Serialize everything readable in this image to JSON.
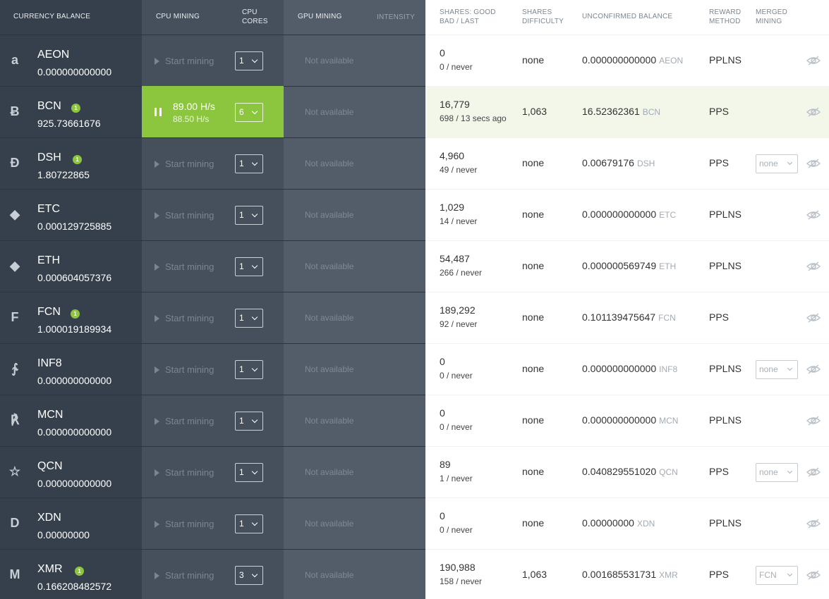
{
  "headers": {
    "currency_balance": "CURRENCY BALANCE",
    "cpu_mining": "CPU MINING",
    "cpu_cores": "CPU CORES",
    "gpu_mining": "GPU MINING",
    "intensity": "INTENSITY",
    "shares": "SHARES: GOOD BAD / LAST",
    "shares_difficulty": "SHARES DIFFICULTY",
    "unconfirmed_balance": "UNCONFIRMED BALANCE",
    "reward_method": "REWARD METHOD",
    "merged_mining": "MERGED MINING"
  },
  "labels": {
    "start_mining": "Start mining",
    "not_available": "Not available",
    "active_rate": "89.00 H/s",
    "active_rate_avg": "88.50 H/s"
  },
  "colors": {
    "accent": "#8cc63f",
    "panel_dark": "#36404c",
    "panel_mid": "#46505c",
    "panel_light": "#535d69"
  },
  "rows": [
    {
      "icon": "aeon-icon",
      "glyph": "a",
      "name": "AEON",
      "badge": "",
      "balance": "0.000000000000",
      "cores": "1",
      "shares_good": "0",
      "shares_bad_last": "0 / never",
      "difficulty": "none",
      "unconfirmed": "0.000000000000",
      "ucur": "AEON",
      "reward": "PPLNS",
      "merged": ""
    },
    {
      "icon": "bcn-icon",
      "glyph": "Ƀ",
      "name": "BCN",
      "badge": "1",
      "balance": "925.73661676",
      "cores": "6",
      "shares_good": "16,779",
      "shares_bad_last": "698 / 13 secs ago",
      "difficulty": "1,063",
      "unconfirmed": "16.52362361",
      "ucur": "BCN",
      "reward": "PPS",
      "merged": "",
      "active": true
    },
    {
      "icon": "dsh-icon",
      "glyph": "Đ",
      "name": "DSH",
      "badge": "1",
      "balance": "1.80722865",
      "cores": "1",
      "shares_good": "4,960",
      "shares_bad_last": "49 / never",
      "difficulty": "none",
      "unconfirmed": "0.00679176",
      "ucur": "DSH",
      "reward": "PPS",
      "merged": "none"
    },
    {
      "icon": "etc-icon",
      "glyph": "◆",
      "name": "ETC",
      "badge": "",
      "balance": "0.000129725885",
      "cores": "1",
      "shares_good": "1,029",
      "shares_bad_last": "14 / never",
      "difficulty": "none",
      "unconfirmed": "0.000000000000",
      "ucur": "ETC",
      "reward": "PPLNS",
      "merged": ""
    },
    {
      "icon": "eth-icon",
      "glyph": "◆",
      "name": "ETH",
      "badge": "",
      "balance": "0.000604057376",
      "cores": "1",
      "shares_good": "54,487",
      "shares_bad_last": "266 / never",
      "difficulty": "none",
      "unconfirmed": "0.000000569749",
      "ucur": "ETH",
      "reward": "PPLNS",
      "merged": ""
    },
    {
      "icon": "fcn-icon",
      "glyph": "F",
      "name": "FCN",
      "badge": "1",
      "balance": "1.000019189934",
      "cores": "1",
      "shares_good": "189,292",
      "shares_bad_last": "92 / never",
      "difficulty": "none",
      "unconfirmed": "0.101139475647",
      "ucur": "FCN",
      "reward": "PPS",
      "merged": ""
    },
    {
      "icon": "inf8-icon",
      "glyph": "∱",
      "name": "INF8",
      "badge": "",
      "balance": "0.000000000000",
      "cores": "1",
      "shares_good": "0",
      "shares_bad_last": "0 / never",
      "difficulty": "none",
      "unconfirmed": "0.000000000000",
      "ucur": "INF8",
      "reward": "PPLNS",
      "merged": "none"
    },
    {
      "icon": "mcn-icon",
      "glyph": "℟",
      "name": "MCN",
      "badge": "",
      "balance": "0.000000000000",
      "cores": "1",
      "shares_good": "0",
      "shares_bad_last": "0 / never",
      "difficulty": "none",
      "unconfirmed": "0.000000000000",
      "ucur": "MCN",
      "reward": "PPLNS",
      "merged": ""
    },
    {
      "icon": "qcn-icon",
      "glyph": "☆",
      "name": "QCN",
      "badge": "",
      "balance": "0.000000000000",
      "cores": "1",
      "shares_good": "89",
      "shares_bad_last": "1 / never",
      "difficulty": "none",
      "unconfirmed": "0.040829551020",
      "ucur": "QCN",
      "reward": "PPS",
      "merged": "none"
    },
    {
      "icon": "xdn-icon",
      "glyph": "D",
      "name": "XDN",
      "badge": "",
      "balance": "0.00000000",
      "cores": "1",
      "shares_good": "0",
      "shares_bad_last": "0 / never",
      "difficulty": "none",
      "unconfirmed": "0.00000000",
      "ucur": "XDN",
      "reward": "PPLNS",
      "merged": ""
    },
    {
      "icon": "xmr-icon",
      "glyph": "M",
      "name": "XMR",
      "badge": "1",
      "balance": "0.166208482572",
      "cores": "3",
      "shares_good": "190,988",
      "shares_bad_last": "158 / never",
      "difficulty": "1,063",
      "unconfirmed": "0.001685531731",
      "ucur": "XMR",
      "reward": "PPS",
      "merged": "FCN"
    }
  ]
}
